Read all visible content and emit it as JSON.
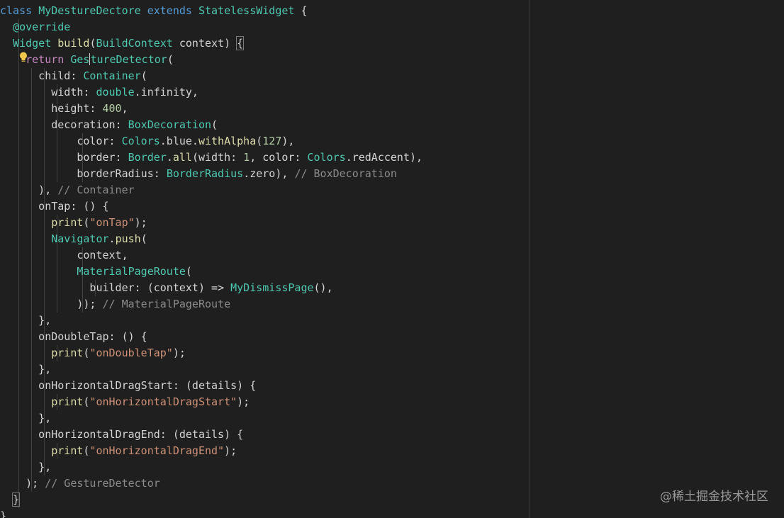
{
  "editor": {
    "lines": [
      [
        {
          "t": "class ",
          "c": "keyword"
        },
        {
          "t": "MyDestureDectore ",
          "c": "type"
        },
        {
          "t": "extends ",
          "c": "keyword"
        },
        {
          "t": "StatelessWidget ",
          "c": "type"
        },
        {
          "t": "{",
          "c": "plain"
        }
      ],
      [
        {
          "t": "  "
        },
        {
          "t": "@override",
          "c": "anno"
        }
      ],
      [
        {
          "t": "  "
        },
        {
          "t": "Widget ",
          "c": "type"
        },
        {
          "t": "build",
          "c": "func"
        },
        {
          "t": "("
        },
        {
          "t": "BuildContext ",
          "c": "type"
        },
        {
          "t": "context) "
        },
        {
          "t": "{",
          "c": "plain",
          "box": true
        }
      ],
      [
        {
          "t": "    "
        },
        {
          "t": "return ",
          "c": "return"
        },
        {
          "t": "Ges",
          "c": "type"
        },
        {
          "cursor": true
        },
        {
          "t": "tureDetector",
          "c": "type"
        },
        {
          "t": "("
        }
      ],
      [
        {
          "t": "      child: "
        },
        {
          "t": "Container",
          "c": "type"
        },
        {
          "t": "("
        }
      ],
      [
        {
          "t": "        width: "
        },
        {
          "t": "double",
          "c": "type"
        },
        {
          "t": ".infinity,"
        }
      ],
      [
        {
          "t": "        height: "
        },
        {
          "t": "400",
          "c": "number"
        },
        {
          "t": ","
        }
      ],
      [
        {
          "t": "        decoration: "
        },
        {
          "t": "BoxDecoration",
          "c": "type"
        },
        {
          "t": "("
        }
      ],
      [
        {
          "t": "            color: "
        },
        {
          "t": "Colors",
          "c": "type"
        },
        {
          "t": ".blue."
        },
        {
          "t": "withAlpha",
          "c": "func"
        },
        {
          "t": "("
        },
        {
          "t": "127",
          "c": "number"
        },
        {
          "t": "),"
        }
      ],
      [
        {
          "t": "            border: "
        },
        {
          "t": "Border",
          "c": "type"
        },
        {
          "t": "."
        },
        {
          "t": "all",
          "c": "func"
        },
        {
          "t": "(width: "
        },
        {
          "t": "1",
          "c": "number"
        },
        {
          "t": ", color: "
        },
        {
          "t": "Colors",
          "c": "type"
        },
        {
          "t": ".redAccent),"
        }
      ],
      [
        {
          "t": "            borderRadius: "
        },
        {
          "t": "BorderRadius",
          "c": "type"
        },
        {
          "t": ".zero), "
        },
        {
          "t": "// BoxDecoration",
          "c": "comment"
        }
      ],
      [
        {
          "t": "      ), "
        },
        {
          "t": "// Container",
          "c": "comment"
        }
      ],
      [
        {
          "t": "      onTap: () {"
        }
      ],
      [
        {
          "t": "        "
        },
        {
          "t": "print",
          "c": "func"
        },
        {
          "t": "("
        },
        {
          "t": "\"onTap\"",
          "c": "string"
        },
        {
          "t": ");"
        }
      ],
      [
        {
          "t": "        "
        },
        {
          "t": "Navigator",
          "c": "type"
        },
        {
          "t": "."
        },
        {
          "t": "push",
          "c": "func"
        },
        {
          "t": "("
        }
      ],
      [
        {
          "t": "            context,"
        }
      ],
      [
        {
          "t": "            "
        },
        {
          "t": "MaterialPageRoute",
          "c": "type"
        },
        {
          "t": "("
        }
      ],
      [
        {
          "t": "              builder: (context) => "
        },
        {
          "t": "MyDismissPage",
          "c": "type"
        },
        {
          "t": "(),"
        }
      ],
      [
        {
          "t": "            )); "
        },
        {
          "t": "// MaterialPageRoute",
          "c": "comment"
        }
      ],
      [
        {
          "t": "      },"
        }
      ],
      [
        {
          "t": "      onDoubleTap: () {"
        }
      ],
      [
        {
          "t": "        "
        },
        {
          "t": "print",
          "c": "func"
        },
        {
          "t": "("
        },
        {
          "t": "\"onDoubleTap\"",
          "c": "string"
        },
        {
          "t": ");"
        }
      ],
      [
        {
          "t": "      },"
        }
      ],
      [
        {
          "t": "      onHorizontalDragStart: (details) {"
        }
      ],
      [
        {
          "t": "        "
        },
        {
          "t": "print",
          "c": "func"
        },
        {
          "t": "("
        },
        {
          "t": "\"onHorizontalDragStart\"",
          "c": "string"
        },
        {
          "t": ");"
        }
      ],
      [
        {
          "t": "      },"
        }
      ],
      [
        {
          "t": "      onHorizontalDragEnd: (details) {"
        }
      ],
      [
        {
          "t": "        "
        },
        {
          "t": "print",
          "c": "func"
        },
        {
          "t": "("
        },
        {
          "t": "\"onHorizontalDragEnd\"",
          "c": "string"
        },
        {
          "t": ");"
        }
      ],
      [
        {
          "t": "      },"
        }
      ],
      [
        {
          "t": "    ); "
        },
        {
          "t": "// GestureDetector",
          "c": "comment"
        }
      ],
      [
        {
          "t": "  "
        },
        {
          "t": "}",
          "c": "plain",
          "box": true
        }
      ],
      [
        {
          "t": "}"
        }
      ]
    ],
    "lightbulb_icon": "lightbulb-icon",
    "colors": {
      "background": "#1f1f1f",
      "keyword": "#569cd6",
      "type": "#4ec9b0",
      "function": "#dcdcaa",
      "string": "#ce9178",
      "number": "#b5cea8",
      "comment": "#8b8b8b",
      "return": "#c586c0"
    }
  },
  "watermark": {
    "text": "@稀土掘金技术社区"
  }
}
